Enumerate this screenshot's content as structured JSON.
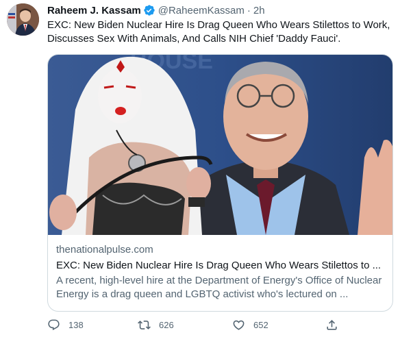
{
  "tweet": {
    "author_name": "Raheem J. Kassam",
    "handle": "@RaheemKassam",
    "separator": "·",
    "time": "2h",
    "text": "EXC: New Biden Nuclear Hire Is Drag Queen Who Wears Stilettos to Work, Discusses Sex With Animals, And Calls NIH Chief 'Daddy Fauci'."
  },
  "card": {
    "domain": "thenationalpulse.com",
    "title": "EXC: New Biden Nuclear Hire Is Drag Queen Who Wears Stilettos to ...",
    "description": "A recent, high-level hire at the Department of Energy's Office of Nuclear Energy is a drag queen and LGBTQ activist who's lectured on ..."
  },
  "actions": {
    "replies": "138",
    "retweets": "626",
    "likes": "652"
  },
  "colors": {
    "verified": "#1d9bf0",
    "muted_text": "#536471",
    "border": "#cfd9de"
  },
  "icons": [
    "verified-badge-icon",
    "reply-icon",
    "retweet-icon",
    "like-icon",
    "share-icon"
  ]
}
